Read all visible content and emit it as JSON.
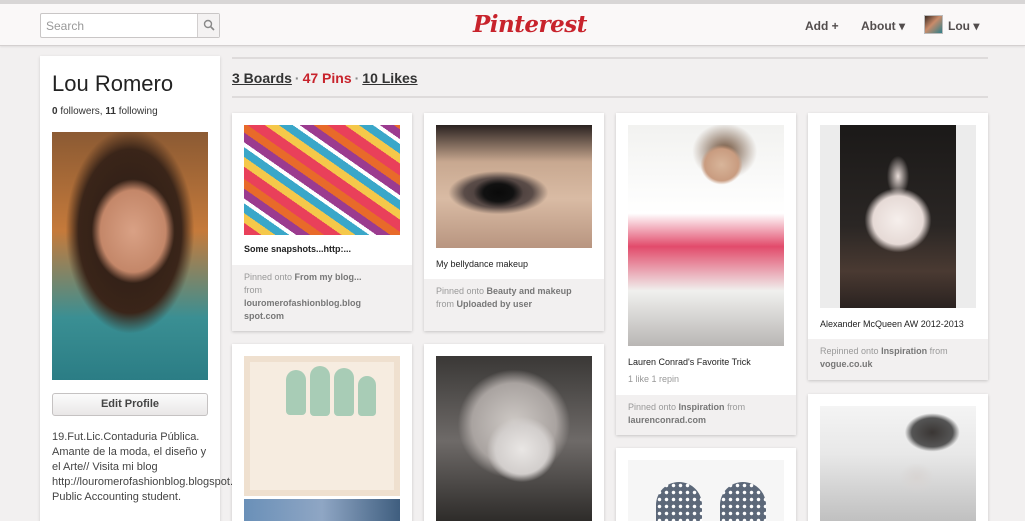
{
  "header": {
    "search_placeholder": "Search",
    "logo": "Pinterest",
    "nav": {
      "add": "Add +",
      "about": "About ▾",
      "user": "Lou ▾"
    }
  },
  "profile": {
    "name": "Lou Romero",
    "followers_count": "0",
    "followers_label": " followers, ",
    "following_count": "11",
    "following_label": " following",
    "edit_button": "Edit Profile",
    "bio": "19.Fut.Lic.Contaduria Pública. Amante de la moda, el diseño y el Arte// Visita mi blog http://louromerofashionblog.blogspot.com/// Public Accounting student."
  },
  "tabs": {
    "boards": "3 Boards",
    "pins": "47 Pins",
    "likes": "10 Likes",
    "sep": "·"
  },
  "pins": [
    {
      "desc": "Some snapshots...http:...",
      "foot_pre": "Pinned onto ",
      "board": "From my blog...",
      "foot_from": "from",
      "source": "louromerofashionblog.blog spot.com"
    },
    {
      "desc": "My bellydance makeup",
      "foot_pre": "Pinned onto ",
      "board": "Beauty and makeup",
      "foot_from": " from ",
      "source": "Uploaded by user"
    },
    {
      "desc": "Lauren Conrad's Favorite Trick",
      "meta": "1 like  1 repin",
      "foot_pre": "Pinned onto ",
      "board": "Inspiration",
      "foot_from": " from",
      "source": "laurenconrad.com"
    },
    {
      "desc": "Alexander McQueen AW 2012-2013",
      "foot_pre": "Repinned onto ",
      "board": "Inspiration",
      "foot_from": " from",
      "source": "vogue.co.uk"
    }
  ],
  "colors": {
    "brand_red": "#c8232c",
    "page_bg": "#f2f0f0"
  }
}
